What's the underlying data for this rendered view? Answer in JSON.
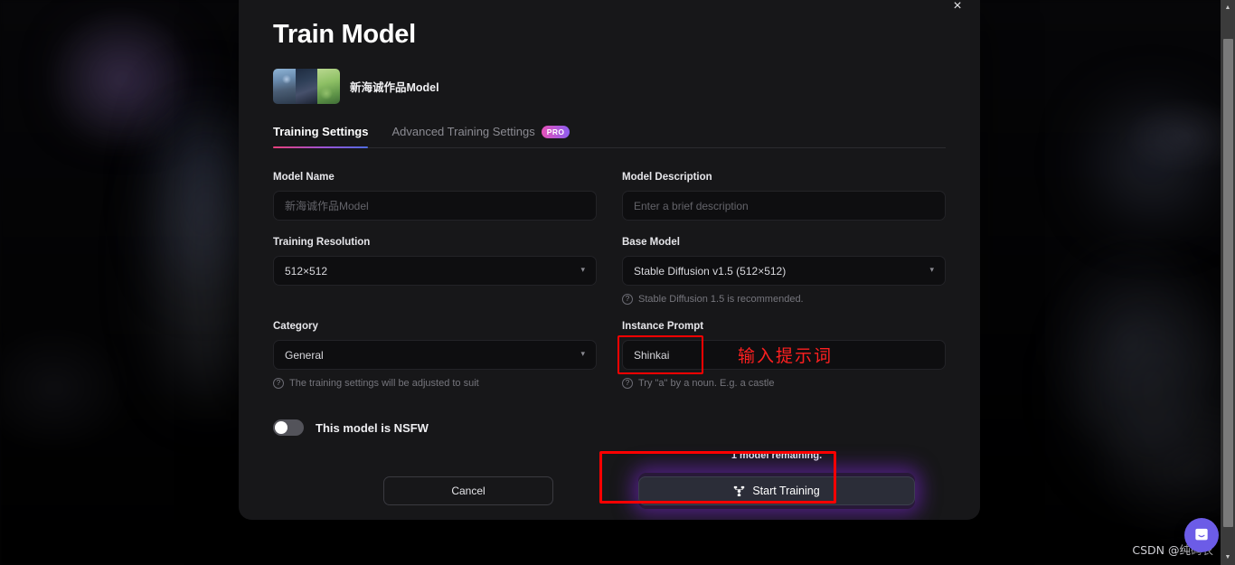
{
  "modal": {
    "title": "Train Model",
    "close_label": "×",
    "model_name": "新海诚作品Model",
    "tabs": [
      {
        "label": "Training Settings",
        "active": true,
        "badge": null
      },
      {
        "label": "Advanced Training Settings",
        "active": false,
        "badge": "PRO"
      }
    ],
    "fields": {
      "model_name": {
        "label": "Model Name",
        "value": "",
        "placeholder": "新海诚作品Model"
      },
      "model_description": {
        "label": "Model Description",
        "value": "",
        "placeholder": "Enter a brief description"
      },
      "training_resolution": {
        "label": "Training Resolution",
        "value": "512×512",
        "caret": "▾"
      },
      "base_model": {
        "label": "Base Model",
        "value": "Stable Diffusion v1.5 (512×512)",
        "caret": "▾",
        "hint": "Stable Diffusion 1.5 is recommended."
      },
      "category": {
        "label": "Category",
        "value": "General",
        "caret": "▾",
        "hint": "The training settings will be adjusted to suit"
      },
      "instance_prompt": {
        "label": "Instance Prompt",
        "value": "Shinkai",
        "hint": "Try \"a\" by a noun. E.g. a castle"
      }
    },
    "hint_icon": "?",
    "nsfw": {
      "label": "This model is NSFW",
      "enabled": false
    },
    "footer": {
      "cancel_label": "Cancel",
      "remaining_text": "1 model remaining.",
      "start_label": "Start Training"
    }
  },
  "annotations": {
    "instance_prompt_note": "输入提示词",
    "box_color": "#ff0000"
  },
  "overlays": {
    "watermark": "CSDN @纯码农",
    "scrollbar": {
      "up_arrow": "▲",
      "down_arrow": "▼"
    }
  },
  "colors": {
    "modal_bg": "#171719",
    "input_bg": "#0e0e10",
    "accent_gradient_start": "#e8407a",
    "accent_gradient_end": "#4f6ce0",
    "pro_badge_start": "#e652b8",
    "pro_badge_end": "#8c5df0",
    "train_glow": "#8228dc",
    "intercom": "#6c5ce7",
    "annotation_red": "#ff0000"
  }
}
